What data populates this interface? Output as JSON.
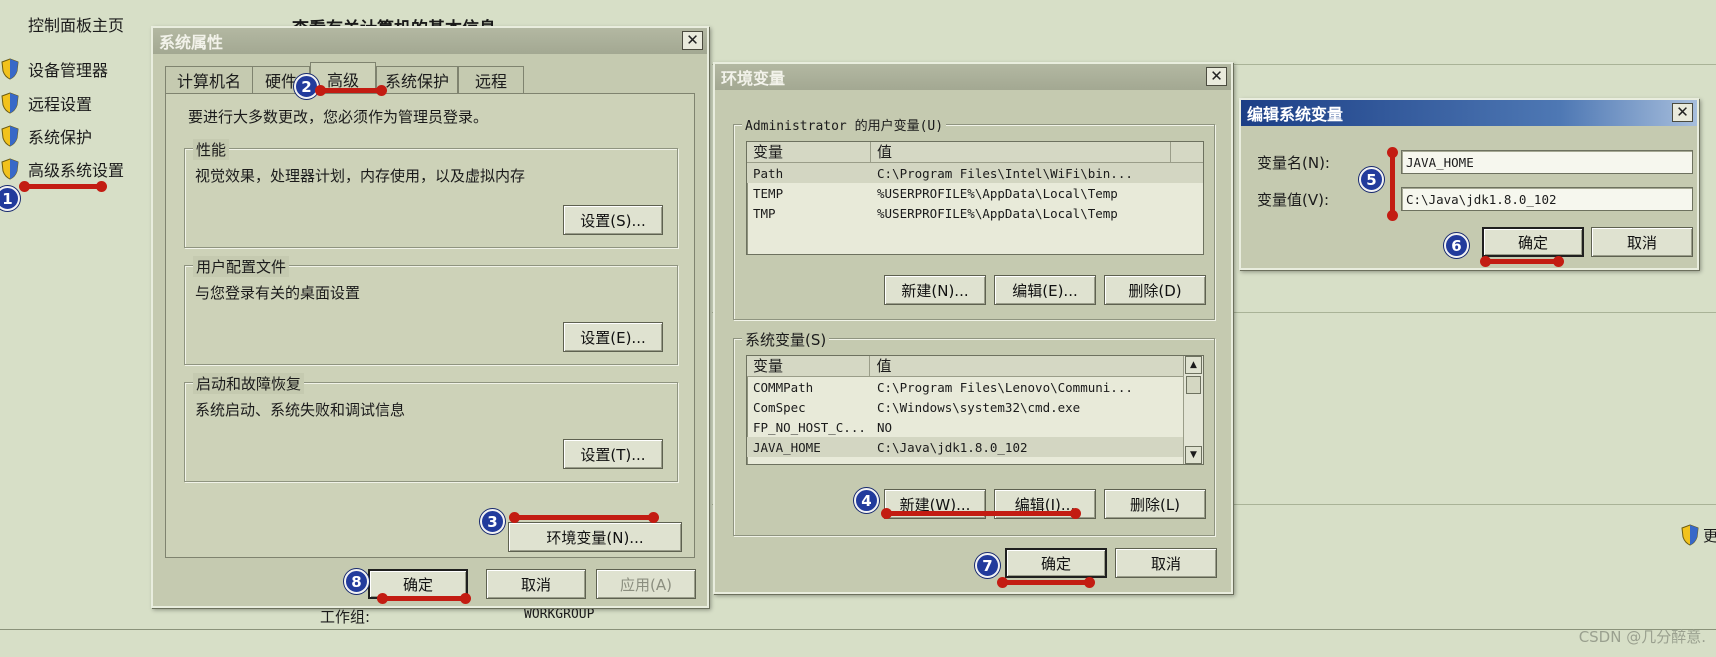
{
  "control_panel": {
    "home": "控制面板主页",
    "links": [
      "设备管理器",
      "远程设置",
      "系统保护",
      "高级系统设置"
    ],
    "heading": "查看有关计算机的基本信息",
    "workgroup_label": "工作组:",
    "workgroup_value": "WORKGROUP",
    "more_label": "更"
  },
  "sysprops": {
    "title": "系统属性",
    "tabs": [
      "计算机名",
      "硬件",
      "高级",
      "系统保护",
      "远程"
    ],
    "active_tab": "高级",
    "admin_note": "要进行大多数更改，您必须作为管理员登录。",
    "groups": [
      {
        "title": "性能",
        "desc": "视觉效果，处理器计划，内存使用，以及虚拟内存",
        "button": "设置(S)..."
      },
      {
        "title": "用户配置文件",
        "desc": "与您登录有关的桌面设置",
        "button": "设置(E)..."
      },
      {
        "title": "启动和故障恢复",
        "desc": "系统启动、系统失败和调试信息",
        "button": "设置(T)..."
      }
    ],
    "env_button": "环境变量(N)...",
    "ok": "确定",
    "cancel": "取消",
    "apply": "应用(A)"
  },
  "envvars": {
    "title": "环境变量",
    "user_group_title": "Administrator 的用户变量(U)",
    "columns": [
      "变量",
      "值"
    ],
    "user_vars": [
      {
        "name": "Path",
        "value": "C:\\Program Files\\Intel\\WiFi\\bin..."
      },
      {
        "name": "TEMP",
        "value": "%USERPROFILE%\\AppData\\Local\\Temp"
      },
      {
        "name": "TMP",
        "value": "%USERPROFILE%\\AppData\\Local\\Temp"
      }
    ],
    "user_buttons": [
      "新建(N)...",
      "编辑(E)...",
      "删除(D)"
    ],
    "system_group_title": "系统变量(S)",
    "system_vars": [
      {
        "name": "COMMPath",
        "value": "C:\\Program Files\\Lenovo\\Communi..."
      },
      {
        "name": "ComSpec",
        "value": "C:\\Windows\\system32\\cmd.exe"
      },
      {
        "name": "FP_NO_HOST_C...",
        "value": "NO"
      },
      {
        "name": "JAVA_HOME",
        "value": "C:\\Java\\jdk1.8.0_102"
      }
    ],
    "system_buttons": [
      "新建(W)...",
      "编辑(I)...",
      "删除(L)"
    ],
    "ok": "确定",
    "cancel": "取消"
  },
  "editvar": {
    "title": "编辑系统变量",
    "name_label": "变量名(N):",
    "name_value": "JAVA_HOME",
    "value_label": "变量值(V):",
    "value_value": "C:\\Java\\jdk1.8.0_102",
    "ok": "确定",
    "cancel": "取消"
  },
  "annotations": {
    "markers": [
      "1",
      "2",
      "3",
      "4",
      "5",
      "6",
      "7",
      "8"
    ],
    "marker_color": "#223b9c",
    "line_color": "#c31c12"
  },
  "watermark": "CSDN @几分醉意."
}
